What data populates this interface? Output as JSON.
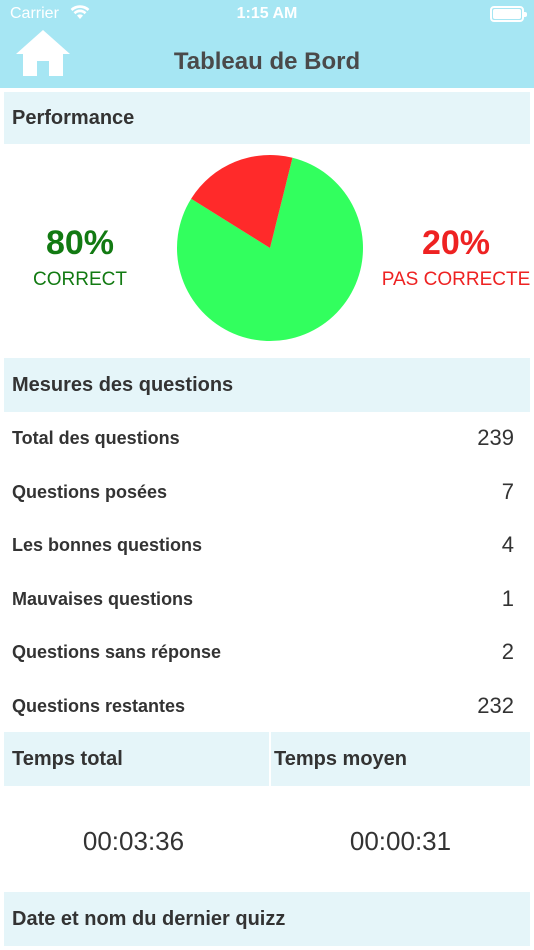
{
  "status_bar": {
    "carrier": "Carrier",
    "time": "1:15 AM"
  },
  "header": {
    "title": "Tableau de Bord",
    "home_icon": "home-icon"
  },
  "performance": {
    "section_title": "Performance",
    "correct_value": "80%",
    "correct_label": "CORRECT",
    "incorrect_value": "20%",
    "incorrect_label": "PAS CORRECTE",
    "correct_color": "#32ff5e",
    "incorrect_color": "#ff2a2a",
    "correct_fraction": 0.8
  },
  "metrics": {
    "section_title": "Mesures des questions",
    "rows": [
      {
        "label": "Total des questions",
        "value": "239"
      },
      {
        "label": "Questions posées",
        "value": "7"
      },
      {
        "label": "Les bonnes questions",
        "value": "4"
      },
      {
        "label": "Mauvaises questions",
        "value": "1"
      },
      {
        "label": "Questions sans réponse",
        "value": "2"
      },
      {
        "label": "Questions restantes",
        "value": "232"
      }
    ]
  },
  "times": {
    "total_label": "Temps total",
    "average_label": "Temps moyen",
    "total_value": "00:03:36",
    "average_value": "00:00:31"
  },
  "last_quiz": {
    "section_title": "Date et nom du dernier quizz"
  }
}
